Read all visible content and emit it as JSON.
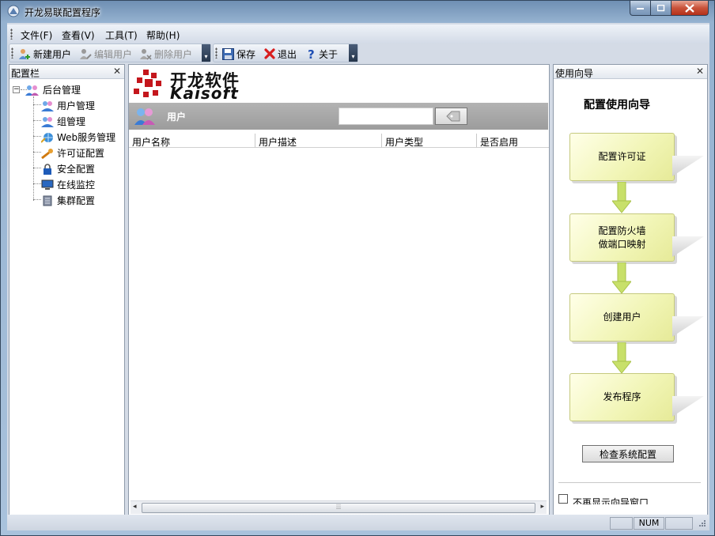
{
  "window": {
    "title": "开龙易联配置程序"
  },
  "menu": [
    "文件(F)",
    "查看(V)",
    "工具(T)",
    "帮助(H)"
  ],
  "toolbar": {
    "new_user": "新建用户",
    "edit_user": "编辑用户",
    "delete_user": "删除用户",
    "save": "保存",
    "exit": "退出",
    "about": "关于"
  },
  "config_panel": {
    "title": "配置栏",
    "root": "后台管理",
    "items": [
      "用户管理",
      "组管理",
      "Web服务管理",
      "许可证配置",
      "安全配置",
      "在线监控",
      "集群配置"
    ]
  },
  "logo": {
    "cn": "开龙软件",
    "en": "Kaisoft"
  },
  "user_section": {
    "label": "用户",
    "columns": [
      "用户名称",
      "用户描述",
      "用户类型",
      "是否启用"
    ],
    "search_value": ""
  },
  "wizard": {
    "panel_title": "使用向导",
    "title": "配置使用向导",
    "steps": [
      "配置许可证",
      "配置防火墙\n做端口映射",
      "创建用户",
      "发布程序"
    ],
    "check_button": "检查系统配置",
    "checkbox_label": "不再显示向导窗口"
  },
  "status": {
    "num": "NUM"
  },
  "colors": {
    "wizard_box": "#f1f5b5",
    "arrow": "#c8e06a",
    "delete_red": "#d81e1e",
    "help_blue": "#1f4fb4"
  }
}
